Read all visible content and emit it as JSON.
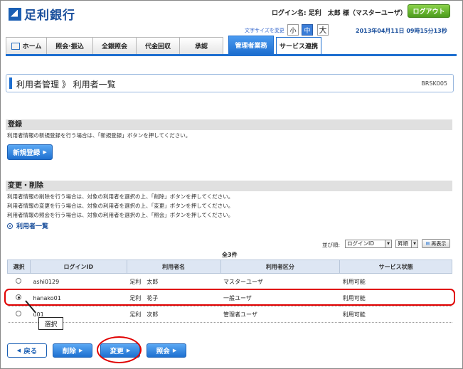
{
  "header": {
    "bank_name": "足利銀行",
    "login_label": "ログイン名:",
    "login_user": "足利　太郎 様（マスターユーザ）",
    "logout_label": "ログアウト",
    "fontsize_label": "文字サイズを変更",
    "fontsize_small": "小",
    "fontsize_mid": "中",
    "fontsize_large": "大",
    "datetime": "2013年04月11日 09時15分13秒"
  },
  "nav": {
    "items": [
      {
        "label": "ホーム"
      },
      {
        "label": "照会·振込"
      },
      {
        "label": "全銀照会"
      },
      {
        "label": "代金回収"
      },
      {
        "label": "承認"
      },
      {
        "label": "管理者業務"
      },
      {
        "label": "サービス連携"
      }
    ]
  },
  "page": {
    "title": "利用者管理 》 利用者一覧",
    "code": "BRSK005"
  },
  "register": {
    "heading": "登録",
    "desc": "利用者情報の新規登録を行う場合は、「新規登録」ボタンを押してください。",
    "button": "新規登録"
  },
  "modify": {
    "heading": "変更・削除",
    "desc1": "利用者情報の削除を行う場合は、対象の利用者を選択の上、「削除」ボタンを押してください。",
    "desc2": "利用者情報の変更を行う場合は、対象の利用者を選択の上、「変更」ボタンを押してください。",
    "desc3": "利用者情報の照会を行う場合は、対象の利用者を選択の上、「照会」ボタンを押してください。"
  },
  "list": {
    "title": "利用者一覧",
    "sort_label": "並び順:",
    "sort_key": "ログインID",
    "sort_order": "昇順",
    "redisplay": "再表示",
    "count": "全3件",
    "columns": [
      "選択",
      "ログインID",
      "利用者名",
      "利用者区分",
      "サービス状態"
    ],
    "rows": [
      {
        "id": "ashi0129",
        "name": "足利　太郎",
        "type": "マスターユーザ",
        "status": "利用可能",
        "selected": false
      },
      {
        "id": "hanako01",
        "name": "足利　花子",
        "type": "一般ユーザ",
        "status": "利用可能",
        "selected": true
      },
      {
        "id": "u01",
        "name": "足利　次郎",
        "type": "管理者ユーザ",
        "status": "利用可能",
        "selected": false
      }
    ]
  },
  "annotation": {
    "callout": "選択"
  },
  "buttons": {
    "back": "戻る",
    "delete": "削除",
    "change": "変更",
    "inquiry": "照会"
  }
}
